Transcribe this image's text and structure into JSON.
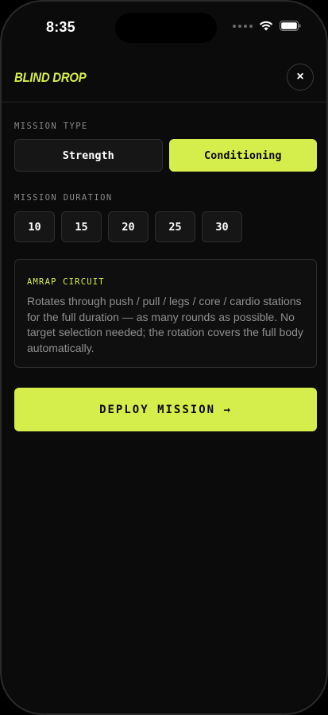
{
  "status_bar": {
    "time": "8:35"
  },
  "header": {
    "title": "BLIND DROP",
    "close_icon": "×"
  },
  "mission_type": {
    "label": "MISSION TYPE",
    "options": [
      "Strength",
      "Conditioning"
    ],
    "selected": "Conditioning"
  },
  "mission_duration": {
    "label": "MISSION DURATION",
    "options": [
      "10",
      "15",
      "20",
      "25",
      "30"
    ]
  },
  "info": {
    "title": "AMRAP CIRCUIT",
    "body": "Rotates through push / pull / legs / core / cardio stations for the full duration — as many rounds as possible. No target selection needed; the rotation covers the full body automatically."
  },
  "deploy": {
    "label": "DEPLOY MISSION →"
  },
  "colors": {
    "accent": "#d6ee4c",
    "background": "#0b0b0b",
    "surface": "#161616"
  }
}
